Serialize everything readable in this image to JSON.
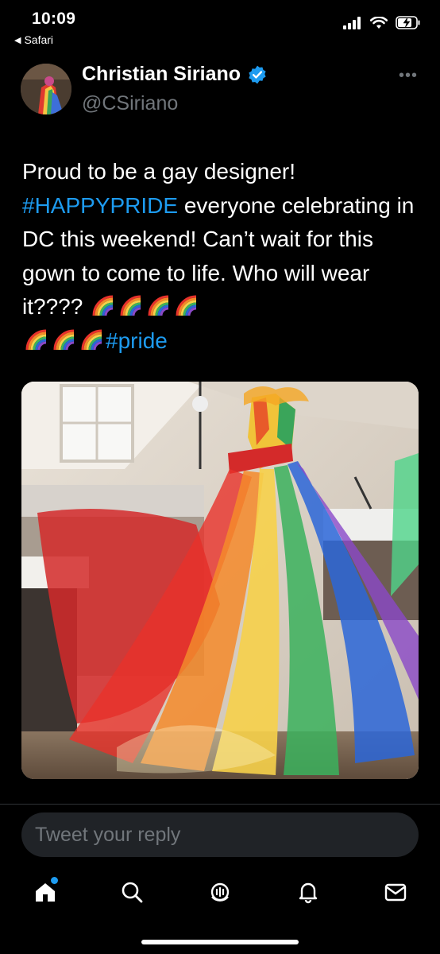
{
  "status_bar": {
    "time": "10:09",
    "back_app": "Safari",
    "icons": [
      "cellular-signal-icon",
      "wifi-icon",
      "battery-charging-icon"
    ]
  },
  "tweet": {
    "author_name": "Christian Siriano",
    "verified": true,
    "handle": "@CSiriano",
    "text_parts": {
      "line1": "Proud to be a gay designer!",
      "hashtag1": "#HAPPYPRIDE",
      "after_hashtag1": " everyone celebrating in DC this weekend! Can’t wait for this gown to come to life. Who will wear it????",
      "hashtag2": "#pride"
    },
    "rainbow_emoji_count": 7,
    "media_description_icon": "photo-rainbow-gown"
  },
  "reply": {
    "placeholder": "Tweet your reply"
  },
  "tabbar": {
    "items": [
      "home-icon",
      "search-icon",
      "spaces-icon",
      "notifications-icon",
      "messages-icon"
    ],
    "active": "home-icon"
  },
  "colors": {
    "background": "#000000",
    "accent": "#1d9bf0",
    "secondary_text": "#71767b",
    "reply_bg": "#202327"
  }
}
